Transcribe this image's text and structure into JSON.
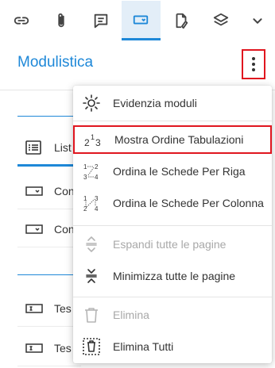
{
  "toolbar": {
    "buttons": [
      {
        "icon": "link-icon"
      },
      {
        "icon": "paperclip-icon"
      },
      {
        "icon": "comment-icon"
      },
      {
        "icon": "form-field-icon",
        "active": true
      },
      {
        "icon": "signature-doc-icon"
      },
      {
        "icon": "layers-icon"
      },
      {
        "icon": "chevron-down-icon"
      }
    ]
  },
  "header": {
    "title": "Modulistica",
    "more_icon": "kebab-menu-icon"
  },
  "background": {
    "tab_label": "List",
    "rows": [
      {
        "label": "Con",
        "icon": "dropdown-field-icon"
      },
      {
        "label": "Con",
        "icon": "dropdown-field-icon"
      },
      {
        "label": "Tes",
        "icon": "text-field-icon"
      },
      {
        "label": "Tes",
        "icon": "text-field-icon"
      }
    ]
  },
  "menu": {
    "items": [
      {
        "label": "Evidenzia moduli",
        "icon": "highlight-sun-icon"
      },
      {
        "label": "Mostra Ordine Tabulazioni",
        "icon": "tab-order-icon",
        "highlighted": true
      },
      {
        "label": "Ordina le Schede Per Riga",
        "icon": "sort-by-row-icon"
      },
      {
        "label": "Ordina le Schede Per Colonna",
        "icon": "sort-by-column-icon"
      },
      {
        "label": "Espandi tutte le pagine",
        "icon": "expand-pages-icon",
        "disabled": true
      },
      {
        "label": "Minimizza tutte le pagine",
        "icon": "collapse-pages-icon"
      },
      {
        "label": "Elimina",
        "icon": "trash-icon",
        "disabled": true
      },
      {
        "label": "Elimina Tutti",
        "icon": "delete-all-icon"
      }
    ]
  },
  "colors": {
    "accent": "#1e88d8",
    "highlight_border": "#e0161f",
    "disabled_text": "#a8a8a8"
  }
}
